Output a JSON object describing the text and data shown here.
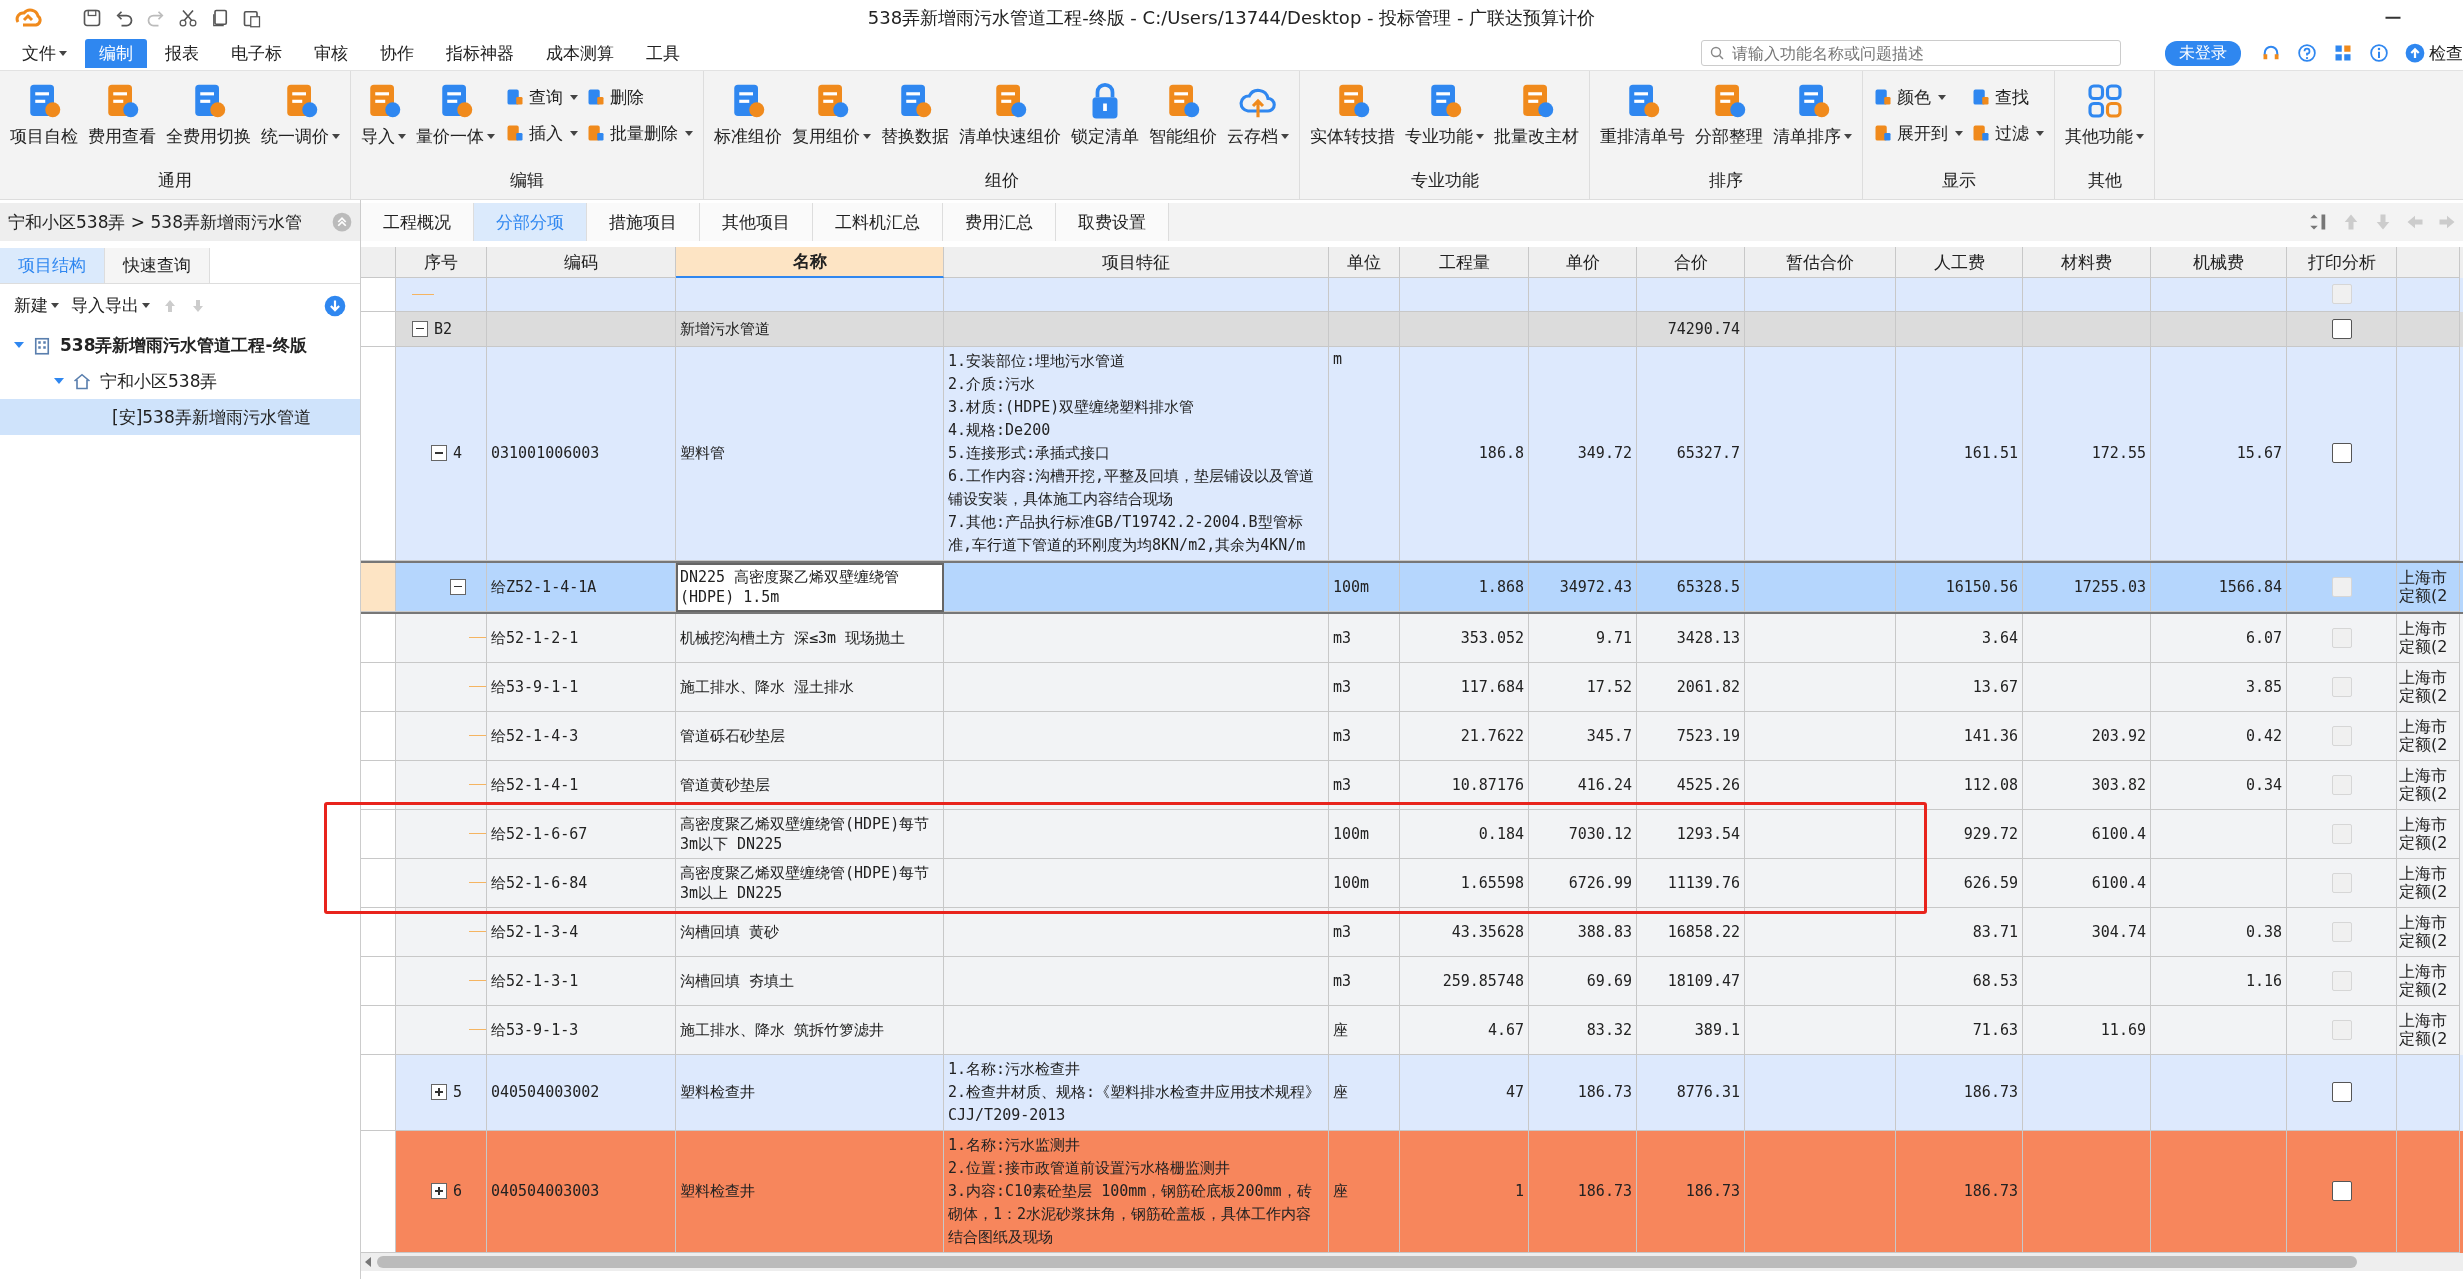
{
  "window": {
    "title": "538弄新增雨污水管道工程-终版 - C:/Users/13744/Desktop - 投标管理 - 广联达预算计价"
  },
  "menu": [
    {
      "label": "文件",
      "dropdown": true,
      "selected": false
    },
    {
      "label": "编制",
      "dropdown": false,
      "selected": true
    },
    {
      "label": "报表",
      "dropdown": false,
      "selected": false
    },
    {
      "label": "电子标",
      "dropdown": false,
      "selected": false
    },
    {
      "label": "审核",
      "dropdown": false,
      "selected": false
    },
    {
      "label": "协作",
      "dropdown": false,
      "selected": false
    },
    {
      "label": "指标神器",
      "dropdown": false,
      "selected": false
    },
    {
      "label": "成本测算",
      "dropdown": false,
      "selected": false
    },
    {
      "label": "工具",
      "dropdown": false,
      "selected": false
    }
  ],
  "search": {
    "placeholder": "请输入功能名称或问题描述"
  },
  "login_badge": "未登录",
  "check_update": "检查",
  "ribbon": [
    {
      "title": "通用",
      "buttons": [
        {
          "kind": "large",
          "label": "项目自检",
          "dropdown": false
        },
        {
          "kind": "large",
          "label": "费用查看",
          "dropdown": false
        },
        {
          "kind": "large",
          "label": "全费用切换",
          "dropdown": false
        },
        {
          "kind": "large",
          "label": "统一调价",
          "dropdown": true
        }
      ]
    },
    {
      "title": "编辑",
      "buttons": [
        {
          "kind": "large",
          "label": "导入",
          "dropdown": true
        },
        {
          "kind": "large",
          "label": "量价一体",
          "dropdown": true
        },
        {
          "kind": "small",
          "label": "查询",
          "dropdown": true
        },
        {
          "kind": "small",
          "label": "插入",
          "dropdown": true
        },
        {
          "kind": "small",
          "label": "删除",
          "dropdown": false
        },
        {
          "kind": "small",
          "label": "批量删除",
          "dropdown": true
        }
      ]
    },
    {
      "title": "组价",
      "buttons": [
        {
          "kind": "large",
          "label": "标准组价",
          "dropdown": false
        },
        {
          "kind": "large",
          "label": "复用组价",
          "dropdown": true
        },
        {
          "kind": "large",
          "label": "替换数据",
          "dropdown": false
        },
        {
          "kind": "large",
          "label": "清单快速组价",
          "dropdown": false
        },
        {
          "kind": "large",
          "label": "锁定清单",
          "dropdown": false
        },
        {
          "kind": "large",
          "label": "智能组价",
          "dropdown": false
        },
        {
          "kind": "large",
          "label": "云存档",
          "dropdown": true
        }
      ]
    },
    {
      "title": "专业功能",
      "buttons": [
        {
          "kind": "large",
          "label": "实体转技措",
          "dropdown": false
        },
        {
          "kind": "large",
          "label": "专业功能",
          "dropdown": true
        },
        {
          "kind": "large",
          "label": "批量改主材",
          "dropdown": false
        }
      ]
    },
    {
      "title": "排序",
      "buttons": [
        {
          "kind": "large",
          "label": "重排清单号",
          "dropdown": false
        },
        {
          "kind": "large",
          "label": "分部整理",
          "dropdown": false
        },
        {
          "kind": "large",
          "label": "清单排序",
          "dropdown": true
        }
      ]
    },
    {
      "title": "显示",
      "buttons": [
        {
          "kind": "small",
          "label": "颜色",
          "dropdown": true
        },
        {
          "kind": "small",
          "label": "展开到",
          "dropdown": true
        },
        {
          "kind": "small",
          "label": "查找",
          "dropdown": false
        },
        {
          "kind": "small",
          "label": "过滤",
          "dropdown": true
        }
      ]
    },
    {
      "title": "其他",
      "buttons": [
        {
          "kind": "large",
          "label": "其他功能",
          "dropdown": true
        }
      ]
    }
  ],
  "breadcrumb": "宁和小区538弄 > 538弄新增雨污水管",
  "side_tabs": [
    {
      "label": "项目结构",
      "selected": true
    },
    {
      "label": "快速查询",
      "selected": false
    }
  ],
  "side_toolbar": [
    {
      "label": "新建",
      "dropdown": true
    },
    {
      "label": "导入导出",
      "dropdown": true
    }
  ],
  "project_tree": [
    {
      "label": "538弄新增雨污水管道工程-终版",
      "expanded": true,
      "selected": false,
      "children": [
        {
          "label": "宁和小区538弄",
          "expanded": true,
          "selected": false,
          "children": [
            {
              "label": "[安]538弄新增雨污水管道",
              "selected": true
            }
          ]
        }
      ]
    }
  ],
  "doc_tabs": [
    {
      "label": "工程概况",
      "selected": false
    },
    {
      "label": "分部分项",
      "selected": true
    },
    {
      "label": "措施项目",
      "selected": false
    },
    {
      "label": "其他项目",
      "selected": false
    },
    {
      "label": "工料机汇总",
      "selected": false
    },
    {
      "label": "费用汇总",
      "selected": false
    },
    {
      "label": "取费设置",
      "selected": false
    }
  ],
  "table": {
    "columns": [
      {
        "label": "序号",
        "selected": false
      },
      {
        "label": "编码",
        "selected": false
      },
      {
        "label": "名称",
        "selected": true
      },
      {
        "label": "项目特征",
        "selected": false
      },
      {
        "label": "单位",
        "selected": false
      },
      {
        "label": "工程量",
        "selected": false
      },
      {
        "label": "单价",
        "selected": false
      },
      {
        "label": "合价",
        "selected": false
      },
      {
        "label": "暂估合价",
        "selected": false
      },
      {
        "label": "人工费",
        "selected": false
      },
      {
        "label": "材料费",
        "selected": false
      },
      {
        "label": "机械费",
        "selected": false
      },
      {
        "label": "打印分析",
        "selected": false
      }
    ],
    "rows": [
      {
        "kind": "blank",
        "selected": false,
        "print_checked": false,
        "print_disabled": true
      },
      {
        "kind": "section",
        "seq": "B2",
        "name": "新增污水管道",
        "total": "74290.74",
        "selected": false,
        "expanded": true,
        "print_checked": false,
        "print_disabled": false,
        "children": [
          {
            "kind": "item",
            "seq": "4",
            "code": "031001006003",
            "name": "塑料管",
            "features": "1.安装部位:埋地污水管道\n2.介质:污水\n3.材质:(HDPE)双壁缠绕塑料排水管\n4.规格:De200\n5.连接形式:承插式接口\n6.工作内容:沟槽开挖,平整及回填，垫层铺设以及管道铺设安装，具体施工内容结合现场\n7.其他:产品执行标准GB/T19742.2-2004.B型管标准,车行道下管道的环刚度为均8KN/m2,其余为4KN/m",
            "unit": "m",
            "qty": "186.8",
            "price": "349.72",
            "total": "65327.7",
            "labor": "161.51",
            "material": "172.55",
            "machine": "15.67",
            "selected": false,
            "expanded": true,
            "print_checked": false,
            "print_disabled": false,
            "children": [
              {
                "kind": "quota",
                "code": "给Z52-1-4-1A",
                "name": "DN225 高密度聚乙烯双壁缠绕管(HDPE) 1.5m",
                "unit": "100m",
                "qty": "1.868",
                "price": "34972.43",
                "total": "65328.5",
                "labor": "16150.56",
                "material": "17255.03",
                "machine": "1566.84",
                "note": "上海市定额(2",
                "selected": true,
                "expanded": true,
                "print_checked": false,
                "print_disabled": true,
                "children": [
                  {
                    "kind": "quota",
                    "code": "给52-1-2-1",
                    "name": "机械挖沟槽土方 深≤3m 现场抛土",
                    "unit": "m3",
                    "qty": "353.052",
                    "price": "9.71",
                    "total": "3428.13",
                    "labor": "3.64",
                    "machine": "6.07",
                    "note": "上海市定额(2",
                    "selected": false,
                    "print_checked": false,
                    "print_disabled": true
                  },
                  {
                    "kind": "quota",
                    "code": "给53-9-1-1",
                    "name": "施工排水、降水 湿土排水",
                    "unit": "m3",
                    "qty": "117.684",
                    "price": "17.52",
                    "total": "2061.82",
                    "labor": "13.67",
                    "machine": "3.85",
                    "note": "上海市定额(2",
                    "selected": false,
                    "print_checked": false,
                    "print_disabled": true
                  },
                  {
                    "kind": "quota",
                    "code": "给52-1-4-3",
                    "name": "管道砾石砂垫层",
                    "unit": "m3",
                    "qty": "21.7622",
                    "price": "345.7",
                    "total": "7523.19",
                    "labor": "141.36",
                    "material": "203.92",
                    "machine": "0.42",
                    "note": "上海市定额(2",
                    "selected": false,
                    "print_checked": false,
                    "print_disabled": true
                  },
                  {
                    "kind": "quota",
                    "code": "给52-1-4-1",
                    "name": "管道黄砂垫层",
                    "unit": "m3",
                    "qty": "10.87176",
                    "price": "416.24",
                    "total": "4525.26",
                    "labor": "112.08",
                    "material": "303.82",
                    "machine": "0.34",
                    "note": "上海市定额(2",
                    "selected": false,
                    "print_checked": false,
                    "print_disabled": true
                  },
                  {
                    "kind": "quota",
                    "code": "给52-1-6-67",
                    "name": "高密度聚乙烯双壁缠绕管(HDPE)每节3m以下 DN225",
                    "unit": "100m",
                    "qty": "0.184",
                    "price": "7030.12",
                    "total": "1293.54",
                    "labor": "929.72",
                    "material": "6100.4",
                    "note": "上海市定额(2",
                    "selected": false,
                    "boxed": true,
                    "print_checked": false,
                    "print_disabled": true
                  },
                  {
                    "kind": "quota",
                    "code": "给52-1-6-84",
                    "name": "高密度聚乙烯双壁缠绕管(HDPE)每节3m以上 DN225",
                    "unit": "100m",
                    "qty": "1.65598",
                    "price": "6726.99",
                    "total": "11139.76",
                    "labor": "626.59",
                    "material": "6100.4",
                    "note": "上海市定额(2",
                    "selected": false,
                    "boxed": true,
                    "print_checked": false,
                    "print_disabled": true
                  },
                  {
                    "kind": "quota",
                    "code": "给52-1-3-4",
                    "name": "沟槽回填 黄砂",
                    "unit": "m3",
                    "qty": "43.35628",
                    "price": "388.83",
                    "total": "16858.22",
                    "labor": "83.71",
                    "material": "304.74",
                    "machine": "0.38",
                    "note": "上海市定额(2",
                    "selected": false,
                    "print_checked": false,
                    "print_disabled": true
                  },
                  {
                    "kind": "quota",
                    "code": "给52-1-3-1",
                    "name": "沟槽回填 夯填土",
                    "unit": "m3",
                    "qty": "259.85748",
                    "price": "69.69",
                    "total": "18109.47",
                    "labor": "68.53",
                    "machine": "1.16",
                    "note": "上海市定额(2",
                    "selected": false,
                    "print_checked": false,
                    "print_disabled": true
                  },
                  {
                    "kind": "quota",
                    "code": "给53-9-1-3",
                    "name": "施工排水、降水 筑拆竹箩滤井",
                    "unit": "座",
                    "qty": "4.67",
                    "price": "83.32",
                    "total": "389.1",
                    "labor": "71.63",
                    "material": "11.69",
                    "note": "上海市定额(2",
                    "selected": false,
                    "print_checked": false,
                    "print_disabled": true
                  }
                ]
              }
            ]
          },
          {
            "kind": "item",
            "seq": "5",
            "code": "040504003002",
            "name": "塑料检查井",
            "features": "1.名称:污水检查井\n2.检查井材质、规格:《塑料排水检查井应用技术规程》CJJ/T209-2013",
            "unit": "座",
            "qty": "47",
            "price": "186.73",
            "total": "8776.31",
            "labor": "186.73",
            "selected": false,
            "expanded": false,
            "print_checked": false,
            "print_disabled": false
          },
          {
            "kind": "item",
            "seq": "6",
            "code": "040504003003",
            "name": "塑料检查井",
            "features": "1.名称:污水监测井\n2.位置:接市政管道前设置污水格栅监测井\n3.内容:C10素砼垫层 100mm，钢筋砼底板200mm，砖砌体，1：2水泥砂浆抹角，钢筋砼盖板，具体工作内容结合图纸及现场",
            "unit": "座",
            "qty": "1",
            "price": "186.73",
            "total": "186.73",
            "labor": "186.73",
            "color": "#f7865c",
            "selected": false,
            "expanded": false,
            "print_checked": false,
            "print_disabled": false
          }
        ]
      }
    ]
  }
}
